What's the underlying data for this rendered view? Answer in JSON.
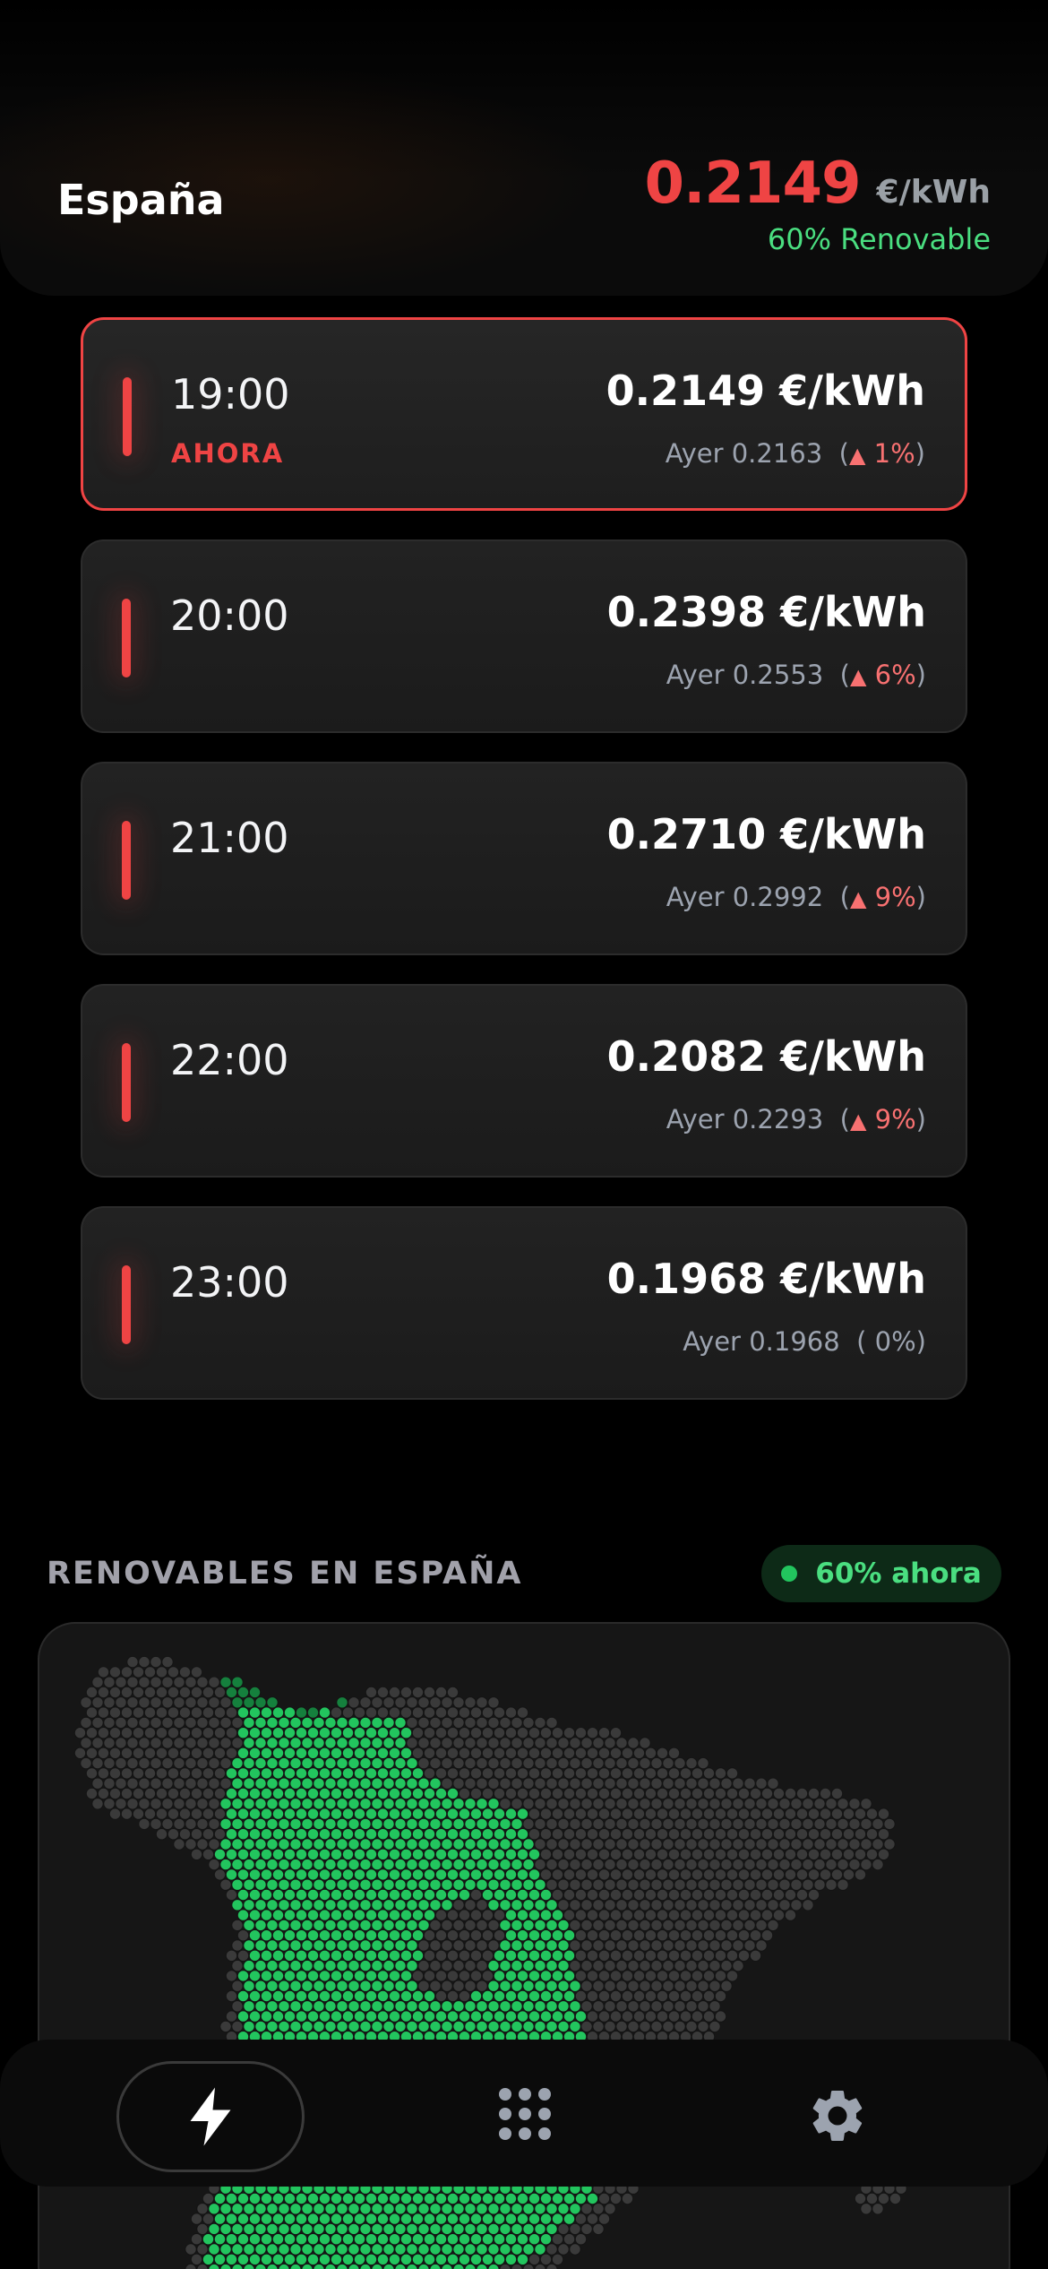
{
  "header": {
    "region": "España",
    "price": "0.2149",
    "unit": "€/kWh",
    "renewable": "60% Renovable"
  },
  "hours": [
    {
      "time": "19:00",
      "now_label": "AHORA",
      "price": "0.2149 €/kWh",
      "yesterday": "Ayer 0.2163",
      "change": "1%",
      "dir": "up",
      "current": true
    },
    {
      "time": "20:00",
      "now_label": "",
      "price": "0.2398 €/kWh",
      "yesterday": "Ayer 0.2553",
      "change": "6%",
      "dir": "up",
      "current": false
    },
    {
      "time": "21:00",
      "now_label": "",
      "price": "0.2710 €/kWh",
      "yesterday": "Ayer 0.2992",
      "change": "9%",
      "dir": "up",
      "current": false
    },
    {
      "time": "22:00",
      "now_label": "",
      "price": "0.2082 €/kWh",
      "yesterday": "Ayer 0.2293",
      "change": "9%",
      "dir": "up",
      "current": false
    },
    {
      "time": "23:00",
      "now_label": "",
      "price": "0.1968 €/kWh",
      "yesterday": "Ayer 0.1968",
      "change": "0%",
      "dir": "none",
      "current": false
    }
  ],
  "renewables": {
    "title": "RENOVABLES EN ESPAÑA",
    "badge": "60% ahora",
    "renewable_share": 0.6
  },
  "colors": {
    "accent_red": "#ef4444",
    "renew_green": "#22c55e",
    "renew_green_dark": "#15803d",
    "inactive_hex": "#3a3a3a"
  },
  "tabbar": {
    "tabs": [
      {
        "icon": "lightning-icon",
        "active": true
      },
      {
        "icon": "grid-icon",
        "active": false
      },
      {
        "icon": "gear-icon",
        "active": false
      }
    ]
  }
}
